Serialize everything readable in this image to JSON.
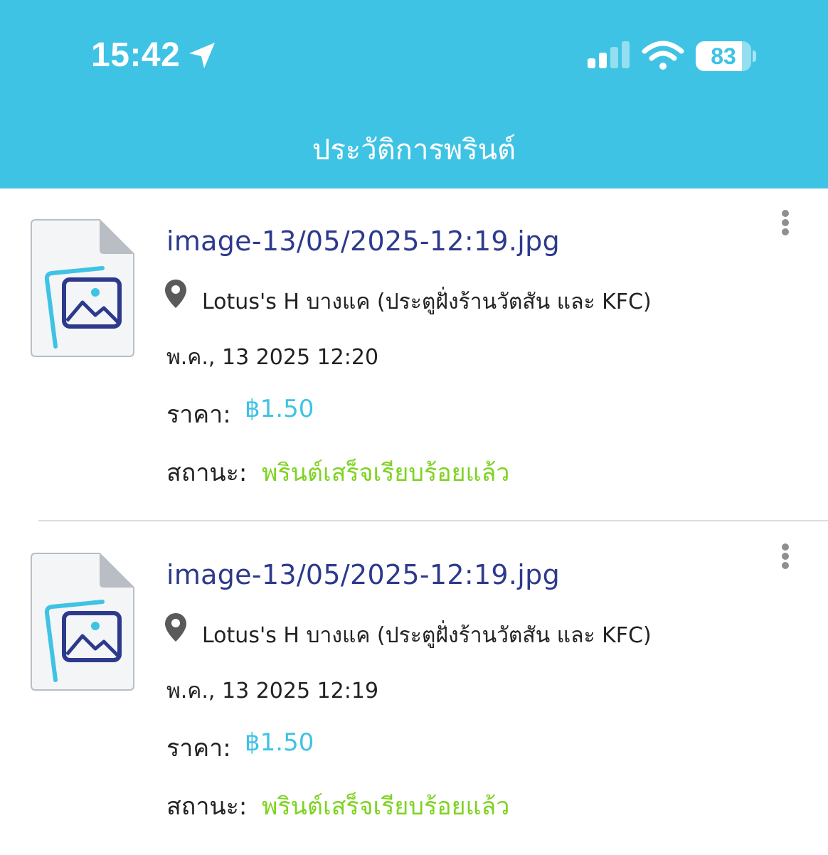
{
  "status_bar": {
    "time": "15:42",
    "battery_level": "83",
    "battery_fraction": 0.83
  },
  "header": {
    "title": "ประวัติการพรินต์"
  },
  "print_history": [
    {
      "filename": "image-13/05/2025-12:19.jpg",
      "location": "Lotus's H บางแค (ประตูฝั่งร้านวัตสัน และ KFC)",
      "datetime": "พ.ค., 13 2025 12:20",
      "price_label": "ราคา:",
      "price_value": "฿1.50",
      "status_label": "สถานะ:",
      "status_value": "พรินต์เสร็จเรียบร้อยแล้ว"
    },
    {
      "filename": "image-13/05/2025-12:19.jpg",
      "location": "Lotus's H บางแค (ประตูฝั่งร้านวัตสัน และ KFC)",
      "datetime": "พ.ค., 13 2025 12:19",
      "price_label": "ราคา:",
      "price_value": "฿1.50",
      "status_label": "สถานะ:",
      "status_value": "พรินต์เสร็จเรียบร้อยแล้ว"
    }
  ],
  "colors": {
    "header_bg": "#3fc3e4",
    "filename": "#2d3a8c",
    "price": "#3fc3e4",
    "status_success": "#7ed321"
  }
}
